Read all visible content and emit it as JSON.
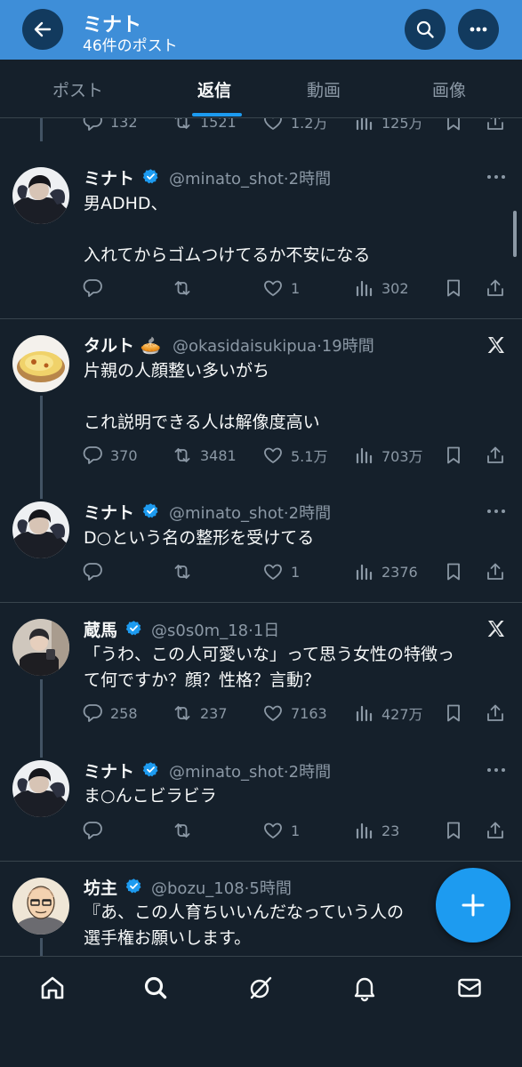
{
  "header": {
    "title": "ミナト",
    "subtitle": "46件のポスト"
  },
  "tabs": [
    {
      "label": "ポスト",
      "active": false
    },
    {
      "label": "返信",
      "active": true
    },
    {
      "label": "動画",
      "active": false
    },
    {
      "label": "画像",
      "active": false
    }
  ],
  "partial_top": {
    "replies": "132",
    "reposts": "1521",
    "likes": "1.2万",
    "views": "125万"
  },
  "posts": [
    {
      "name": "ミナト",
      "handle": "@minato_shot",
      "time": "2時間",
      "text": "男ADHD、\n\n入れてからゴムつけてるか不安になる",
      "replies": "",
      "reposts": "",
      "likes": "1",
      "views": "302"
    },
    {
      "name": "タルト",
      "emoji": "🥧",
      "handle": "@okasidaisukipua",
      "time": "19時間",
      "text": "片親の人顔整い多いがち\n\nこれ説明できる人は解像度高い",
      "replies": "370",
      "reposts": "3481",
      "likes": "5.1万",
      "views": "703万"
    },
    {
      "name": "ミナト",
      "handle": "@minato_shot",
      "time": "2時間",
      "text": "D○という名の整形を受けてる",
      "replies": "",
      "reposts": "",
      "likes": "1",
      "views": "2376"
    },
    {
      "name": "蔵馬",
      "handle": "@s0s0m_18",
      "time": "1日",
      "text": "「うわ、この人可愛いな」って思う女性の特徴っ\nて何ですか？顔？性格？言動？",
      "replies": "258",
      "reposts": "237",
      "likes": "7163",
      "views": "427万"
    },
    {
      "name": "ミナト",
      "handle": "@minato_shot",
      "time": "2時間",
      "text": "ま○んこビラビラ",
      "replies": "",
      "reposts": "",
      "likes": "1",
      "views": "23"
    },
    {
      "name": "坊主",
      "handle": "@bozu_108",
      "time": "5時間",
      "text": "『あ、この人育ちいいんだなっていう人の\n選手権お願いします。",
      "replies": "",
      "reposts": "",
      "likes": "",
      "views": ""
    }
  ],
  "colors": {
    "accent": "#1d9bf0",
    "header": "#3e8ed8",
    "background": "#15202b",
    "muted": "#8b98a5"
  },
  "icons": [
    "back-arrow-icon",
    "search-icon",
    "more-icon",
    "reply-icon",
    "repost-icon",
    "like-icon",
    "views-icon",
    "bookmark-icon",
    "share-icon",
    "x-logo-icon",
    "compose-plus-icon",
    "home-icon",
    "explore-icon",
    "grok-icon",
    "notifications-icon",
    "messages-icon"
  ]
}
